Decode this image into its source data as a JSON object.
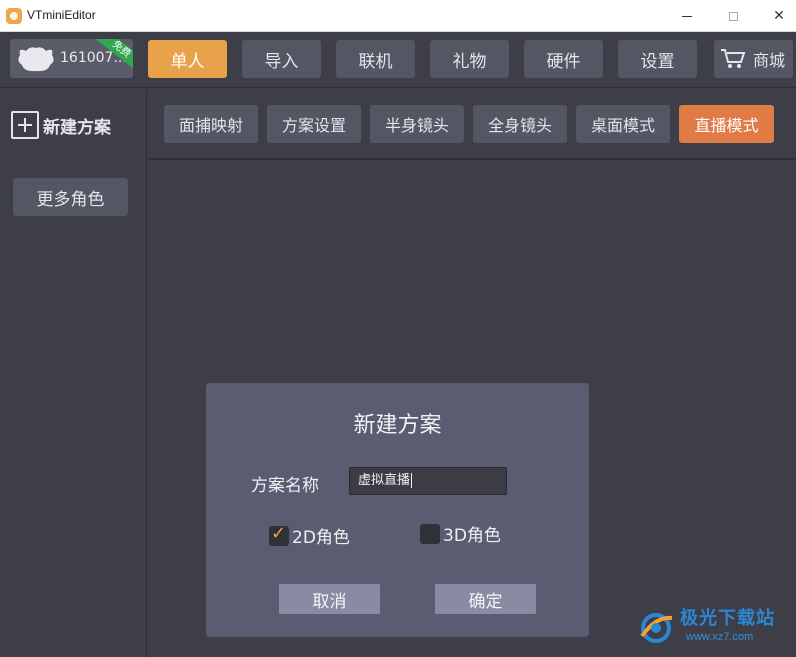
{
  "window": {
    "title": "VTminiEditor"
  },
  "profile": {
    "name": "161007...",
    "badge": "免费"
  },
  "topnav": {
    "items": [
      {
        "label": "单人",
        "active": true
      },
      {
        "label": "导入",
        "active": false
      },
      {
        "label": "联机",
        "active": false
      },
      {
        "label": "礼物",
        "active": false
      },
      {
        "label": "硬件",
        "active": false
      },
      {
        "label": "设置",
        "active": false
      }
    ],
    "shop_label": "商城"
  },
  "sidebar": {
    "new_scheme_label": "新建方案",
    "more_roles_label": "更多角色"
  },
  "subtabs": [
    {
      "label": "面捕映射",
      "active": false
    },
    {
      "label": "方案设置",
      "active": false
    },
    {
      "label": "半身镜头",
      "active": false
    },
    {
      "label": "全身镜头",
      "active": false
    },
    {
      "label": "桌面模式",
      "active": false
    },
    {
      "label": "直播模式",
      "active": true
    }
  ],
  "dialog": {
    "title": "新建方案",
    "name_label": "方案名称",
    "name_value": "虚拟直播",
    "option_2d": {
      "label": "2D角色",
      "checked": true
    },
    "option_3d": {
      "label": "3D角色",
      "checked": false
    },
    "cancel_label": "取消",
    "confirm_label": "确定"
  },
  "watermark": {
    "text": "极光下载站",
    "url": "www.xz7.com"
  },
  "colors": {
    "accent_orange": "#e8a24a",
    "live_mode_orange": "#e07b45",
    "background": "#3d3e47",
    "button": "#555663",
    "dialog": "#5b5b72"
  }
}
